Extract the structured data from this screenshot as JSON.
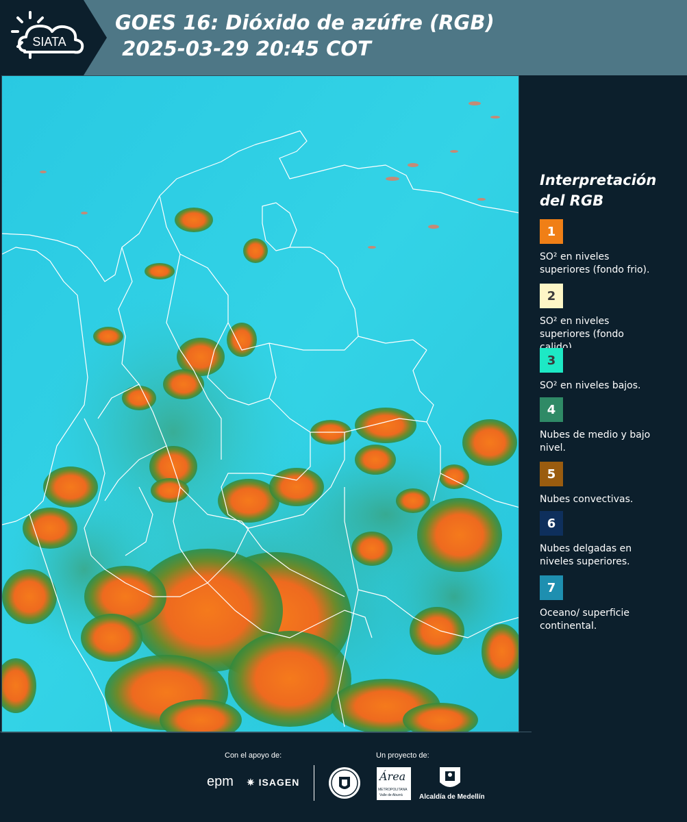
{
  "header": {
    "logo_text": "SIATA",
    "title_line1": "GOES 16: Dióxido de azúfre (RGB)",
    "title_line2": " 2025-03-29 20:45 COT"
  },
  "legend": {
    "title_line1": "Interpretación",
    "title_line2": "del RGB",
    "items": [
      {
        "number": "1",
        "color": "#f07f16",
        "text": "SO² en niveles superiores (fondo frio)."
      },
      {
        "number": "2",
        "color": "#fdf6c6",
        "text": "SO² en niveles superiores (fondo calido)."
      },
      {
        "number": "3",
        "color": "#1de9c5",
        "text": "SO² en niveles bajos."
      },
      {
        "number": "4",
        "color": "#2f8a66",
        "text": "Nubes de medio y bajo nivel."
      },
      {
        "number": "5",
        "color": "#9a5c0f",
        "text": "Nubes convectivas."
      },
      {
        "number": "6",
        "color": "#0e2f5c",
        "text": "Nubes delgadas en niveles superiores."
      },
      {
        "number": "7",
        "color": "#1e8fb0",
        "text": "Oceano/ superficie continental."
      }
    ]
  },
  "footer": {
    "support_label": "Con el apoyo de:",
    "project_label": "Un proyecto de:",
    "sponsor_epm": "epm",
    "sponsor_isagen": "ISAGEN",
    "area_name": "Área",
    "area_sub1": "METROPOLITANA",
    "area_sub2": "Valle de Aburrá",
    "alcaldia": "Alcaldía de Medellín"
  },
  "colors": {
    "background": "#0c1f2c",
    "header": "#4e7786",
    "ocean": "#2ad0e3",
    "cloud_orange": "#f2711c",
    "cloud_green": "#2f8a3e"
  }
}
